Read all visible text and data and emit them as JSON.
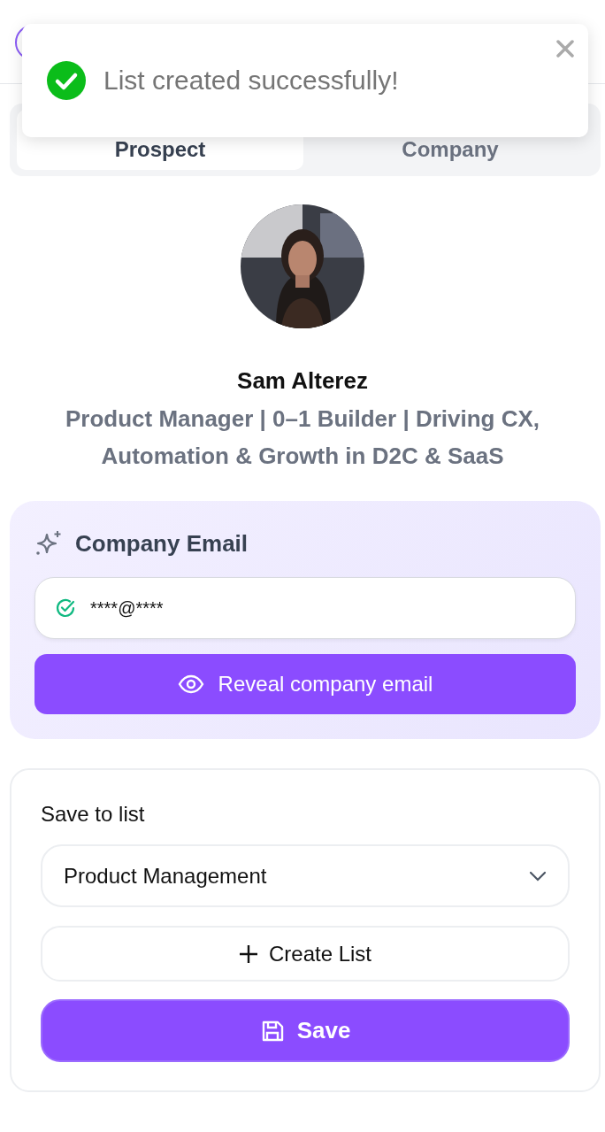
{
  "toast": {
    "kind": "success",
    "message": "List created successfully!"
  },
  "tabs": [
    {
      "label": "Prospect",
      "selected": true
    },
    {
      "label": "Company",
      "selected": false
    }
  ],
  "profile": {
    "name": "Sam Alterez",
    "headline": "Product Manager | 0–1 Builder | Driving CX, Automation & Growth in D2C & SaaS"
  },
  "email_card": {
    "title": "Company Email",
    "value": "****@****",
    "verified": true,
    "button": "Reveal company email"
  },
  "save_card": {
    "label": "Save to list",
    "selected_list": "Product Management",
    "create_button": "Create List",
    "save_button": "Save"
  }
}
